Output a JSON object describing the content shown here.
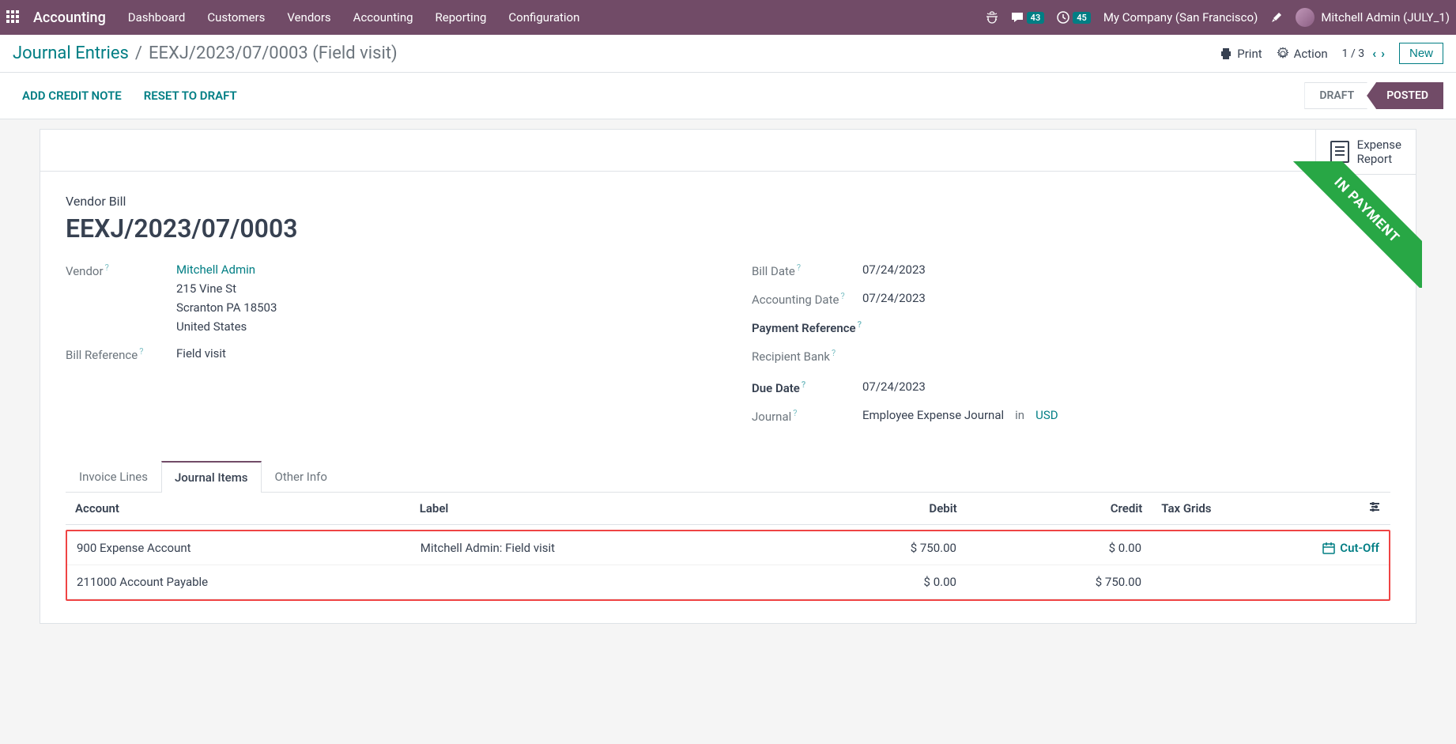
{
  "topbar": {
    "app": "Accounting",
    "menu": [
      "Dashboard",
      "Customers",
      "Vendors",
      "Accounting",
      "Reporting",
      "Configuration"
    ],
    "msg_count": "43",
    "activity_count": "45",
    "company": "My Company (San Francisco)",
    "user": "Mitchell Admin (JULY_1)"
  },
  "breadcrumb": {
    "parent": "Journal Entries",
    "current": "EEXJ/2023/07/0003 (Field visit)",
    "print": "Print",
    "action": "Action",
    "pager": "1 / 3",
    "new_btn": "New"
  },
  "actions": {
    "add_credit_note": "ADD CREDIT NOTE",
    "reset_draft": "RESET TO DRAFT",
    "draft": "DRAFT",
    "posted": "POSTED"
  },
  "stat_button": {
    "line1": "Expense",
    "line2": "Report"
  },
  "ribbon": "IN PAYMENT",
  "doc": {
    "type_label": "Vendor Bill",
    "name": "EEXJ/2023/07/0003",
    "vendor_label": "Vendor",
    "vendor_name": "Mitchell Admin",
    "vendor_addr1": "215 Vine St",
    "vendor_addr2": "Scranton PA 18503",
    "vendor_addr3": "United States",
    "bill_ref_label": "Bill Reference",
    "bill_ref": "Field visit",
    "bill_date_label": "Bill Date",
    "bill_date": "07/24/2023",
    "acct_date_label": "Accounting Date",
    "acct_date": "07/24/2023",
    "pay_ref_label": "Payment Reference",
    "recip_bank_label": "Recipient Bank",
    "due_date_label": "Due Date",
    "due_date": "07/24/2023",
    "journal_label": "Journal",
    "journal": "Employee Expense Journal",
    "journal_in": "in",
    "currency": "USD"
  },
  "tabs": {
    "invoice_lines": "Invoice Lines",
    "journal_items": "Journal Items",
    "other_info": "Other Info"
  },
  "table": {
    "h_account": "Account",
    "h_label": "Label",
    "h_debit": "Debit",
    "h_credit": "Credit",
    "h_tax": "Tax Grids",
    "rows": [
      {
        "account": "900 Expense Account",
        "label": "Mitchell Admin: Field visit",
        "debit": "$ 750.00",
        "credit": "$ 0.00",
        "cutoff": "Cut-Off"
      },
      {
        "account": "211000 Account Payable",
        "label": "",
        "debit": "$ 0.00",
        "credit": "$ 750.00",
        "cutoff": ""
      }
    ]
  }
}
